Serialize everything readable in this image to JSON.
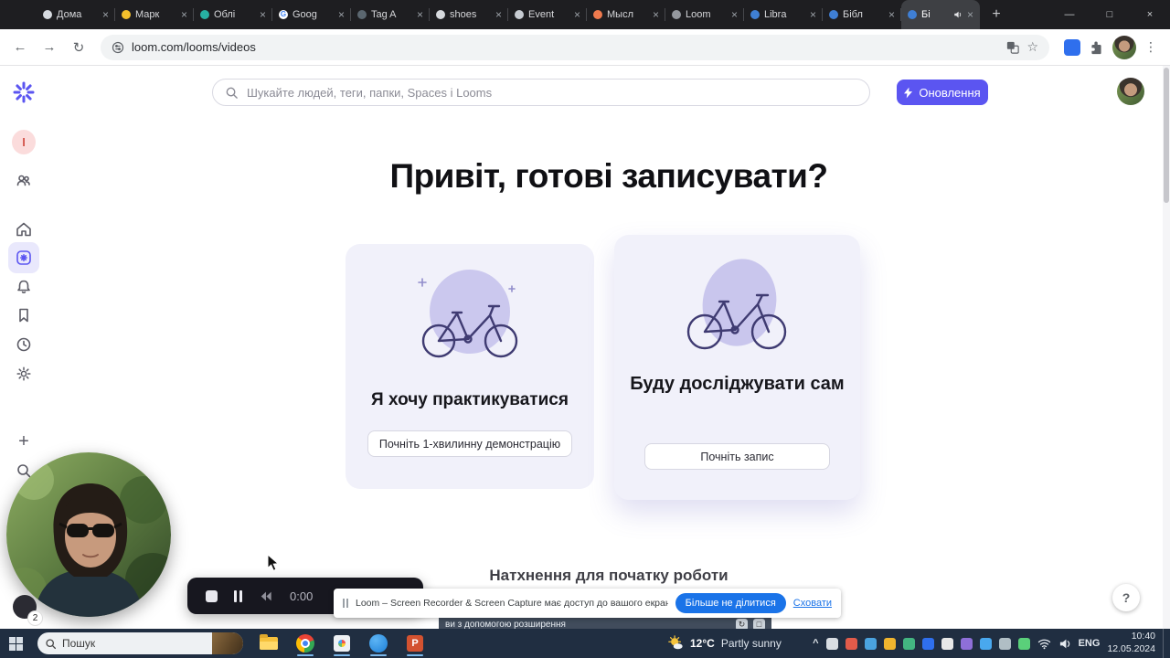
{
  "colors": {
    "accent_purple": "#5b55f1",
    "card_bg": "#f1f1fa",
    "recorder_bg": "#17171f",
    "notification_blue": "#1a73e8",
    "taskbar_bg": "#202e41"
  },
  "icons": {
    "close": "×",
    "minimize": "—",
    "maximize": "□",
    "back": "←",
    "forward": "→",
    "reload": "↻",
    "star": "☆",
    "kebab": "⋮",
    "new_tab": "+",
    "plus": "+",
    "chevron_up": "^",
    "question_mark": "?"
  },
  "browser": {
    "url": "loom.com/looms/videos",
    "tabs": [
      {
        "label": "Дома",
        "favicon": "#d7dbe0"
      },
      {
        "label": "Марк",
        "favicon": "#f3c02c"
      },
      {
        "label": "Облі",
        "favicon": "#27b0a2"
      },
      {
        "label": "Goog",
        "favicon": "#ffffff",
        "glyph": "G"
      },
      {
        "label": "Tag A",
        "favicon": "#5b6770"
      },
      {
        "label": "shoes",
        "favicon": "#d6d9dd"
      },
      {
        "label": "Event",
        "favicon": "#c7ccd2"
      },
      {
        "label": "Мысл",
        "favicon": "#ef7a4e"
      },
      {
        "label": "Loom",
        "favicon": "#95989e"
      },
      {
        "label": "Libra",
        "favicon": "#3f7fd4"
      },
      {
        "label": "Бібл",
        "favicon": "#3f7fd4"
      },
      {
        "label": "Бі",
        "favicon": "#3f7fd4"
      }
    ]
  },
  "loom": {
    "search_placeholder": "Шукайте людей, теги, папки, Spaces і Looms",
    "update_button": "Оновлення",
    "workspace_initial": "I",
    "heading": "Привіт, готові записувати?",
    "cards": [
      {
        "title": "Я хочу практикуватися",
        "button": "Почніть 1-хвилинну демонстрацію"
      },
      {
        "title": "Буду досліджувати сам",
        "button": "Почніть запис"
      }
    ],
    "section_heading": "Натхнення для початку роботи"
  },
  "recorder": {
    "time": "0:00"
  },
  "notification": {
    "text": "Loom – Screen Recorder & Screen Capture має доступ до вашого екрана.",
    "primary_button": "Більше не ділитися",
    "dismiss_link": "Сховати"
  },
  "infobar": {
    "fragment": "ви з допомогою розширення"
  },
  "webcam_badge": "2",
  "taskbar": {
    "search_label": "Пошук",
    "powerpoint_glyph": "P",
    "weather": {
      "temp": "12°C",
      "desc": "Partly sunny"
    },
    "language": "ENG",
    "clock": {
      "time": "10:40",
      "date": "12.05.2024"
    },
    "tray_colors": [
      "#d8dde2",
      "#e25b4a",
      "#4aa3df",
      "#f0b52e",
      "#43b581",
      "#2f6fed",
      "#e8e8e8",
      "#8e6fd8",
      "#49a8ee",
      "#b0bec5",
      "#5ad07a"
    ]
  }
}
